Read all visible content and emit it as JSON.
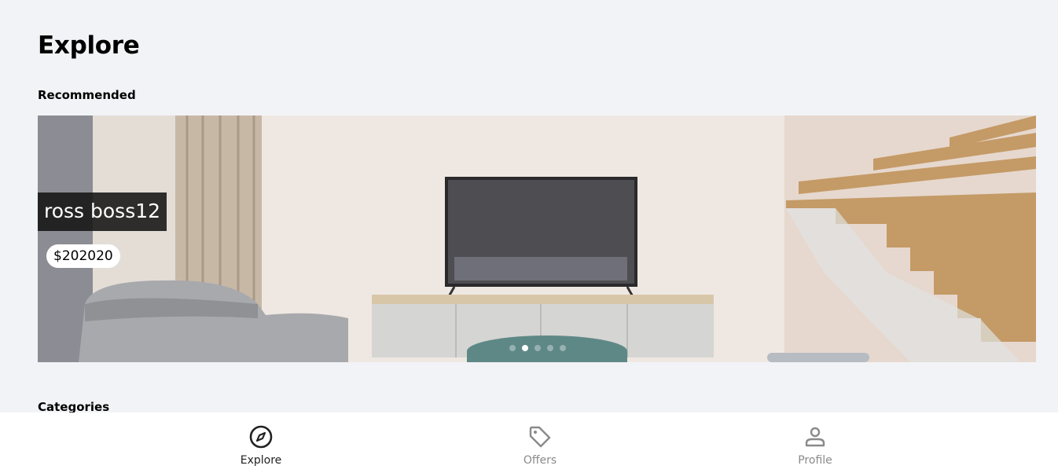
{
  "header": {
    "title": "Explore"
  },
  "sections": {
    "recommended": "Recommended",
    "categories": "Categories"
  },
  "carousel": {
    "listing_name": "ross boss12",
    "listing_price": "$202020",
    "slide_count": 5,
    "active_slide": 1
  },
  "tabbar": {
    "tabs": [
      {
        "label": "Explore",
        "icon": "compass-icon",
        "active": true
      },
      {
        "label": "Offers",
        "icon": "tag-icon",
        "active": false
      },
      {
        "label": "Profile",
        "icon": "person-icon",
        "active": false
      }
    ]
  },
  "colors": {
    "background": "#f2f3f7",
    "active_tab": "#222222",
    "inactive_tab": "#8a8a8a"
  }
}
